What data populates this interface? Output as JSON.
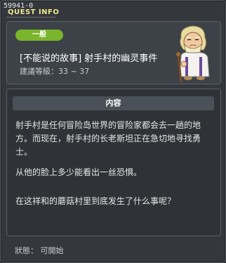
{
  "window": {
    "id": "59941-0",
    "title": "QUEST INFO"
  },
  "quest": {
    "category": "一般",
    "name": "[不能说的故事] 射手村的幽灵事件",
    "level": "建議等級：33 ~ 37"
  },
  "content": {
    "header": "内容",
    "paragraphs": [
      "射手村是任何冒险岛世界的冒险家都会去一趟的地方。而现在，射手村的长老斯坦正在急切地寻找勇士。",
      "从他的脸上多少能看出一丝恐惧。",
      "在这祥和的蘑菇村里到底发生了什么事呢？"
    ]
  },
  "footer": {
    "status": "狀態： 可開始"
  },
  "icons": {
    "npc": "elder-stan-npc-icon"
  },
  "colors": {
    "category_badge": "#7ab52b",
    "title": "#f0e68c"
  }
}
